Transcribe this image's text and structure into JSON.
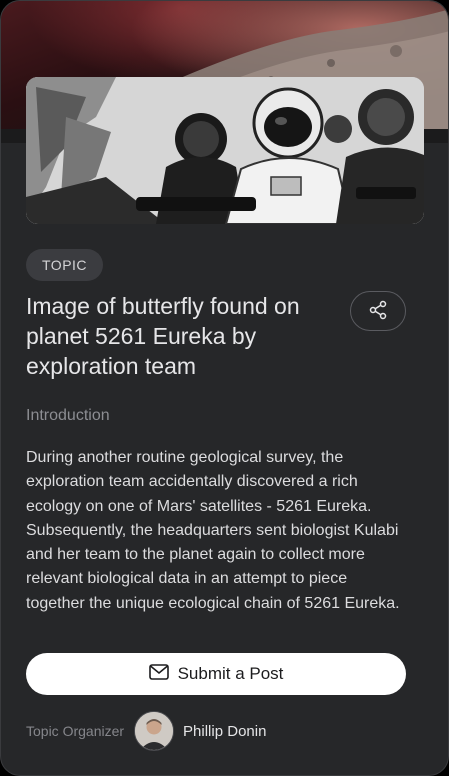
{
  "card": {
    "topic_badge": "TOPIC",
    "title": "Image of butterfly found on planet 5261 Eureka by exploration team",
    "section_label": "Introduction",
    "description": "During another routine geological survey, the exploration team accidentally discovered a rich ecology on one of Mars' satellites - 5261 Eureka. Subsequently, the headquarters sent biologist Kulabi and her team to the planet again to collect more relevant biological data in an attempt to piece together the unique ecological chain of 5261 Eureka.",
    "submit_label": "Submit a Post",
    "organizer_label": "Topic Organizer",
    "organizer_name": "Phillip Donin"
  },
  "icons": {
    "share": "share-icon",
    "submit": "mail-icon"
  },
  "colors": {
    "card_background": "#262729",
    "badge_background": "#3b3c40",
    "button_background": "#ffffff",
    "muted_text": "#8c8d92"
  }
}
